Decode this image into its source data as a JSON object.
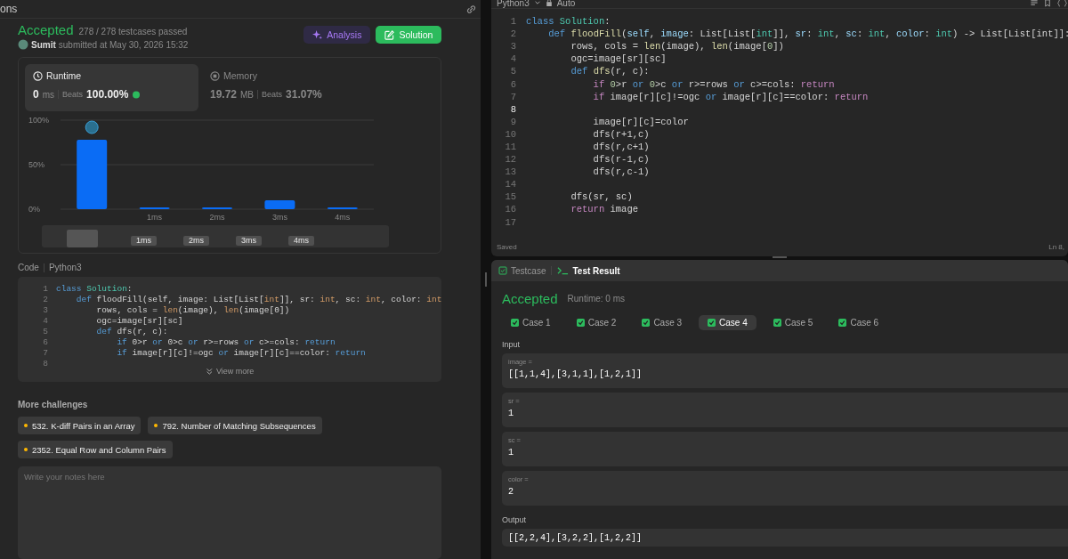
{
  "left_panel": {
    "tab_title": "ons",
    "submission": {
      "status": "Accepted",
      "testcases": "278 / 278 testcases passed",
      "user": "Sumit",
      "submitted": "submitted at May 30, 2026 15:32",
      "buttons": [
        {
          "label": "Analysis",
          "kind": "analysis"
        },
        {
          "label": "Solution",
          "kind": "solution"
        }
      ]
    },
    "stats": [
      {
        "kind": "runtime",
        "title": "Runtime",
        "value": "0",
        "unit": "ms",
        "beats_label": "Beats",
        "beats": "100.00%",
        "selected": true
      },
      {
        "kind": "memory",
        "title": "Memory",
        "value": "19.72",
        "unit": "MB",
        "beats_label": "Beats",
        "beats": "31.07%",
        "selected": false
      }
    ],
    "chart_data": {
      "type": "bar",
      "x": [
        0,
        1,
        2,
        3,
        4
      ],
      "values": [
        78,
        2,
        2,
        10,
        2
      ],
      "xlim": [
        -0.5,
        4.5
      ],
      "ylim": [
        0,
        100
      ],
      "yticks": [
        {
          "value": 0,
          "label": "0%"
        },
        {
          "value": 50,
          "label": "50%"
        },
        {
          "value": 100,
          "label": "100%"
        }
      ],
      "xticks": [
        {
          "value": 1,
          "label": "1ms"
        },
        {
          "value": 2,
          "label": "2ms"
        },
        {
          "value": 3,
          "label": "3ms"
        },
        {
          "value": 4,
          "label": "4ms"
        }
      ]
    },
    "range_labels": [
      "1ms",
      "2ms",
      "3ms",
      "4ms"
    ],
    "code": {
      "label": "Code",
      "language": "Python3",
      "view_more": "View more",
      "lines": [
        {
          "number": "1",
          "tokens": [
            {
              "text": "class ",
              "kind": "kw"
            },
            {
              "text": "Solution",
              "kind": "cls"
            },
            {
              "text": ":",
              "kind": "plain"
            }
          ]
        },
        {
          "number": "2",
          "tokens": [
            {
              "text": "    def",
              "kind": "kw"
            },
            {
              "text": " floodFill(self, image: List[List[",
              "kind": "plain"
            },
            {
              "text": "int",
              "kind": "type"
            },
            {
              "text": "]], sr: ",
              "kind": "plain"
            },
            {
              "text": "int",
              "kind": "type"
            },
            {
              "text": ", sc: ",
              "kind": "plain"
            },
            {
              "text": "int",
              "kind": "type"
            },
            {
              "text": ", color: ",
              "kind": "plain"
            },
            {
              "text": "int",
              "kind": "type"
            }
          ]
        },
        {
          "number": "3",
          "tokens": [
            {
              "text": "        rows, cols = ",
              "kind": "plain"
            },
            {
              "text": "len",
              "kind": "builtin"
            },
            {
              "text": "(image), ",
              "kind": "plain"
            },
            {
              "text": "len",
              "kind": "builtin"
            },
            {
              "text": "(image[0])",
              "kind": "plain"
            }
          ]
        },
        {
          "number": "4",
          "tokens": [
            {
              "text": "        ogc=image[sr][sc]",
              "kind": "plain"
            }
          ]
        },
        {
          "number": "5",
          "tokens": [
            {
              "text": "        def",
              "kind": "kw"
            },
            {
              "text": " dfs(r, c):",
              "kind": "plain"
            }
          ]
        },
        {
          "number": "6",
          "tokens": [
            {
              "text": "            if",
              "kind": "ctl"
            },
            {
              "text": " 0>r ",
              "kind": "plain"
            },
            {
              "text": "or",
              "kind": "kw"
            },
            {
              "text": " 0>c ",
              "kind": "plain"
            },
            {
              "text": "or",
              "kind": "kw"
            },
            {
              "text": " r>=rows ",
              "kind": "plain"
            },
            {
              "text": "or",
              "kind": "kw"
            },
            {
              "text": " c>=cols: ",
              "kind": "plain"
            },
            {
              "text": "return",
              "kind": "ctl"
            }
          ]
        },
        {
          "number": "7",
          "tokens": [
            {
              "text": "            if",
              "kind": "ctl"
            },
            {
              "text": " image[r][c]!=ogc ",
              "kind": "plain"
            },
            {
              "text": "or",
              "kind": "kw"
            },
            {
              "text": " image[r][c]==color: ",
              "kind": "plain"
            },
            {
              "text": "return",
              "kind": "ctl"
            }
          ]
        },
        {
          "number": "8"
        }
      ]
    },
    "more_title": "More challenges",
    "challenges": [
      {
        "title": "532. K-diff Pairs in an Array",
        "color": "#ffb800"
      },
      {
        "title": "792. Number of Matching Subsequences",
        "color": "#ffb800"
      },
      {
        "title": "2352. Equal Row and Column Pairs",
        "color": "#ffb800"
      }
    ],
    "notes": {
      "placeholder": "Write your notes here"
    }
  },
  "editor": {
    "language": "Python3",
    "mode": "Auto",
    "status": "Saved",
    "cursor": "Ln 8,",
    "lines": [
      {
        "number": "1",
        "current": false,
        "tokens": [
          {
            "text": "class ",
            "kind": "kw"
          },
          {
            "text": "Solution",
            "kind": "cls"
          },
          {
            "text": ":",
            "kind": "plain"
          }
        ]
      },
      {
        "number": "2",
        "current": false,
        "tokens": [
          {
            "text": "    def ",
            "kind": "kw"
          },
          {
            "text": "floodFill",
            "kind": "fn"
          },
          {
            "text": "(",
            "kind": "plain"
          },
          {
            "text": "self",
            "kind": "param"
          },
          {
            "text": ", ",
            "kind": "plain"
          },
          {
            "text": "image",
            "kind": "param"
          },
          {
            "text": ": List[List[",
            "kind": "plain"
          },
          {
            "text": "int",
            "kind": "type"
          },
          {
            "text": "]], ",
            "kind": "plain"
          },
          {
            "text": "sr",
            "kind": "param"
          },
          {
            "text": ": ",
            "kind": "plain"
          },
          {
            "text": "int",
            "kind": "type"
          },
          {
            "text": ", ",
            "kind": "plain"
          },
          {
            "text": "sc",
            "kind": "param"
          },
          {
            "text": ": ",
            "kind": "plain"
          },
          {
            "text": "int",
            "kind": "type"
          },
          {
            "text": ", ",
            "kind": "plain"
          },
          {
            "text": "color",
            "kind": "param"
          },
          {
            "text": ": ",
            "kind": "plain"
          },
          {
            "text": "int",
            "kind": "type"
          },
          {
            "text": ") -> List[List[int]]:",
            "kind": "plain"
          }
        ]
      },
      {
        "number": "3",
        "current": false,
        "tokens": [
          {
            "text": "        rows, cols = ",
            "kind": "plain"
          },
          {
            "text": "len",
            "kind": "builtin"
          },
          {
            "text": "(image), ",
            "kind": "plain"
          },
          {
            "text": "len",
            "kind": "builtin"
          },
          {
            "text": "(image[",
            "kind": "plain"
          },
          {
            "text": "0",
            "kind": "num"
          },
          {
            "text": "])",
            "kind": "plain"
          }
        ]
      },
      {
        "number": "4",
        "current": false,
        "tokens": [
          {
            "text": "        ogc=image[sr][sc]",
            "kind": "plain"
          }
        ]
      },
      {
        "number": "5",
        "current": false,
        "tokens": [
          {
            "text": "        def ",
            "kind": "kw"
          },
          {
            "text": "dfs",
            "kind": "fn"
          },
          {
            "text": "(r, c):",
            "kind": "plain"
          }
        ]
      },
      {
        "number": "6",
        "current": false,
        "tokens": [
          {
            "text": "            if ",
            "kind": "ctl"
          },
          {
            "text": "0",
            "kind": "num"
          },
          {
            "text": ">r ",
            "kind": "plain"
          },
          {
            "text": "or ",
            "kind": "kw"
          },
          {
            "text": "0",
            "kind": "num"
          },
          {
            "text": ">c ",
            "kind": "plain"
          },
          {
            "text": "or",
            "kind": "kw"
          },
          {
            "text": " r>=rows ",
            "kind": "plain"
          },
          {
            "text": "or",
            "kind": "kw"
          },
          {
            "text": " c>=cols: ",
            "kind": "plain"
          },
          {
            "text": "return",
            "kind": "ctl"
          }
        ]
      },
      {
        "number": "7",
        "current": false,
        "tokens": [
          {
            "text": "            if",
            "kind": "ctl"
          },
          {
            "text": " image[r][c]!=ogc ",
            "kind": "plain"
          },
          {
            "text": "or",
            "kind": "kw"
          },
          {
            "text": " image[r][c]==color: ",
            "kind": "plain"
          },
          {
            "text": "return",
            "kind": "ctl"
          }
        ]
      },
      {
        "number": "8",
        "current": true
      },
      {
        "number": "9",
        "current": false,
        "tokens": [
          {
            "text": "            image[r][c]=color",
            "kind": "plain"
          }
        ]
      },
      {
        "number": "10",
        "current": false,
        "tokens": [
          {
            "text": "            dfs(r+1,c)",
            "kind": "plain"
          }
        ]
      },
      {
        "number": "11",
        "current": false,
        "tokens": [
          {
            "text": "            dfs(r,c+1)",
            "kind": "plain"
          }
        ]
      },
      {
        "number": "12",
        "current": false,
        "tokens": [
          {
            "text": "            dfs(r-1,c)",
            "kind": "plain"
          }
        ]
      },
      {
        "number": "13",
        "current": false,
        "tokens": [
          {
            "text": "            dfs(r,c-1)",
            "kind": "plain"
          }
        ]
      },
      {
        "number": "14",
        "current": false
      },
      {
        "number": "15",
        "current": false,
        "tokens": [
          {
            "text": "        dfs(sr, sc)",
            "kind": "plain"
          }
        ]
      },
      {
        "number": "16",
        "current": false,
        "tokens": [
          {
            "text": "        return",
            "kind": "ctl"
          },
          {
            "text": " image",
            "kind": "plain"
          }
        ]
      },
      {
        "number": "17",
        "current": false
      }
    ]
  },
  "test_panel": {
    "tabs": [
      {
        "label": "Testcase",
        "selected": false
      },
      {
        "label": "Test Result",
        "selected": true
      }
    ],
    "status": "Accepted",
    "runtime": "Runtime: 0 ms",
    "cases": [
      {
        "label": "Case 1",
        "passed": true,
        "selected": false
      },
      {
        "label": "Case 2",
        "passed": true,
        "selected": false
      },
      {
        "label": "Case 3",
        "passed": true,
        "selected": false
      },
      {
        "label": "Case 4",
        "passed": true,
        "selected": true
      },
      {
        "label": "Case 5",
        "passed": true,
        "selected": false
      },
      {
        "label": "Case 6",
        "passed": true,
        "selected": false
      }
    ],
    "input_label": "Input",
    "inputs": [
      {
        "name": "image =",
        "value": "[[1,1,4],[3,1,1],[1,2,1]]"
      },
      {
        "name": "sr =",
        "value": "1"
      },
      {
        "name": "sc =",
        "value": "1"
      },
      {
        "name": "color =",
        "value": "2"
      }
    ],
    "output_label": "Output",
    "output": "[[2,2,4],[3,2,2],[1,2,2]]"
  }
}
